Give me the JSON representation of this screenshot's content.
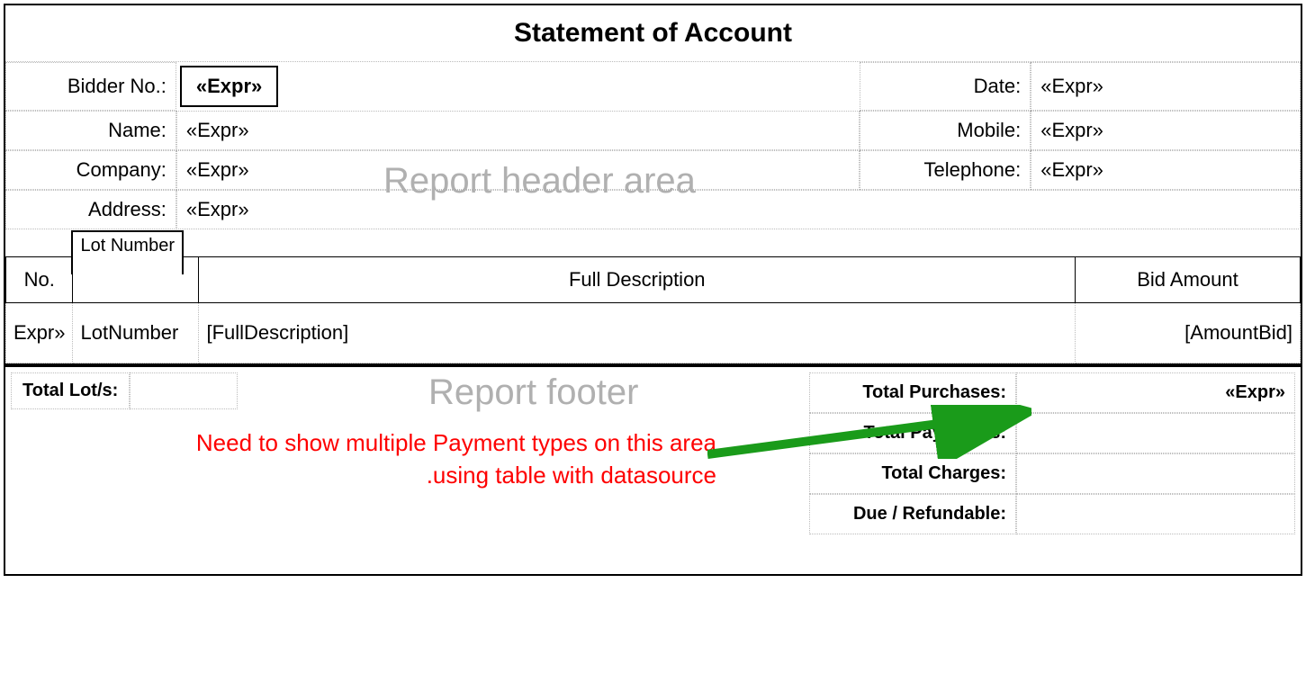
{
  "title": "Statement of Account",
  "header": {
    "bidder_no_label": "Bidder No.:",
    "bidder_no_value": "«Expr»",
    "name_label": "Name:",
    "name_value": "«Expr»",
    "company_label": "Company:",
    "company_value": "«Expr»",
    "address_label": "Address:",
    "address_value": "«Expr»",
    "date_label": "Date:",
    "date_value": "«Expr»",
    "mobile_label": "Mobile:",
    "mobile_value": "«Expr»",
    "telephone_label": "Telephone:",
    "telephone_value": "«Expr»"
  },
  "watermarks": {
    "header": "Report header area",
    "footer": "Report footer"
  },
  "columns": {
    "no": "No.",
    "lot_number_tab": "Lot Number",
    "full_description": "Full Description",
    "bid_amount": "Bid Amount"
  },
  "detail_row": {
    "no": "Expr»",
    "lot_number": "LotNumber",
    "full_description": "[FullDescription]",
    "bid_amount": "[AmountBid]"
  },
  "footer": {
    "total_lots_label": "Total Lot/s:",
    "total_lots_value": "",
    "totals": [
      {
        "label": "Total Purchases:",
        "value": "«Expr»"
      },
      {
        "label": "Total Payment/s:",
        "value": ""
      },
      {
        "label": "Total Charges:",
        "value": ""
      },
      {
        "label": "Due / Refundable:",
        "value": ""
      }
    ]
  },
  "annotation": {
    "line1": "Need to show multiple Payment types on this area",
    "line2": ".using table with datasource"
  }
}
